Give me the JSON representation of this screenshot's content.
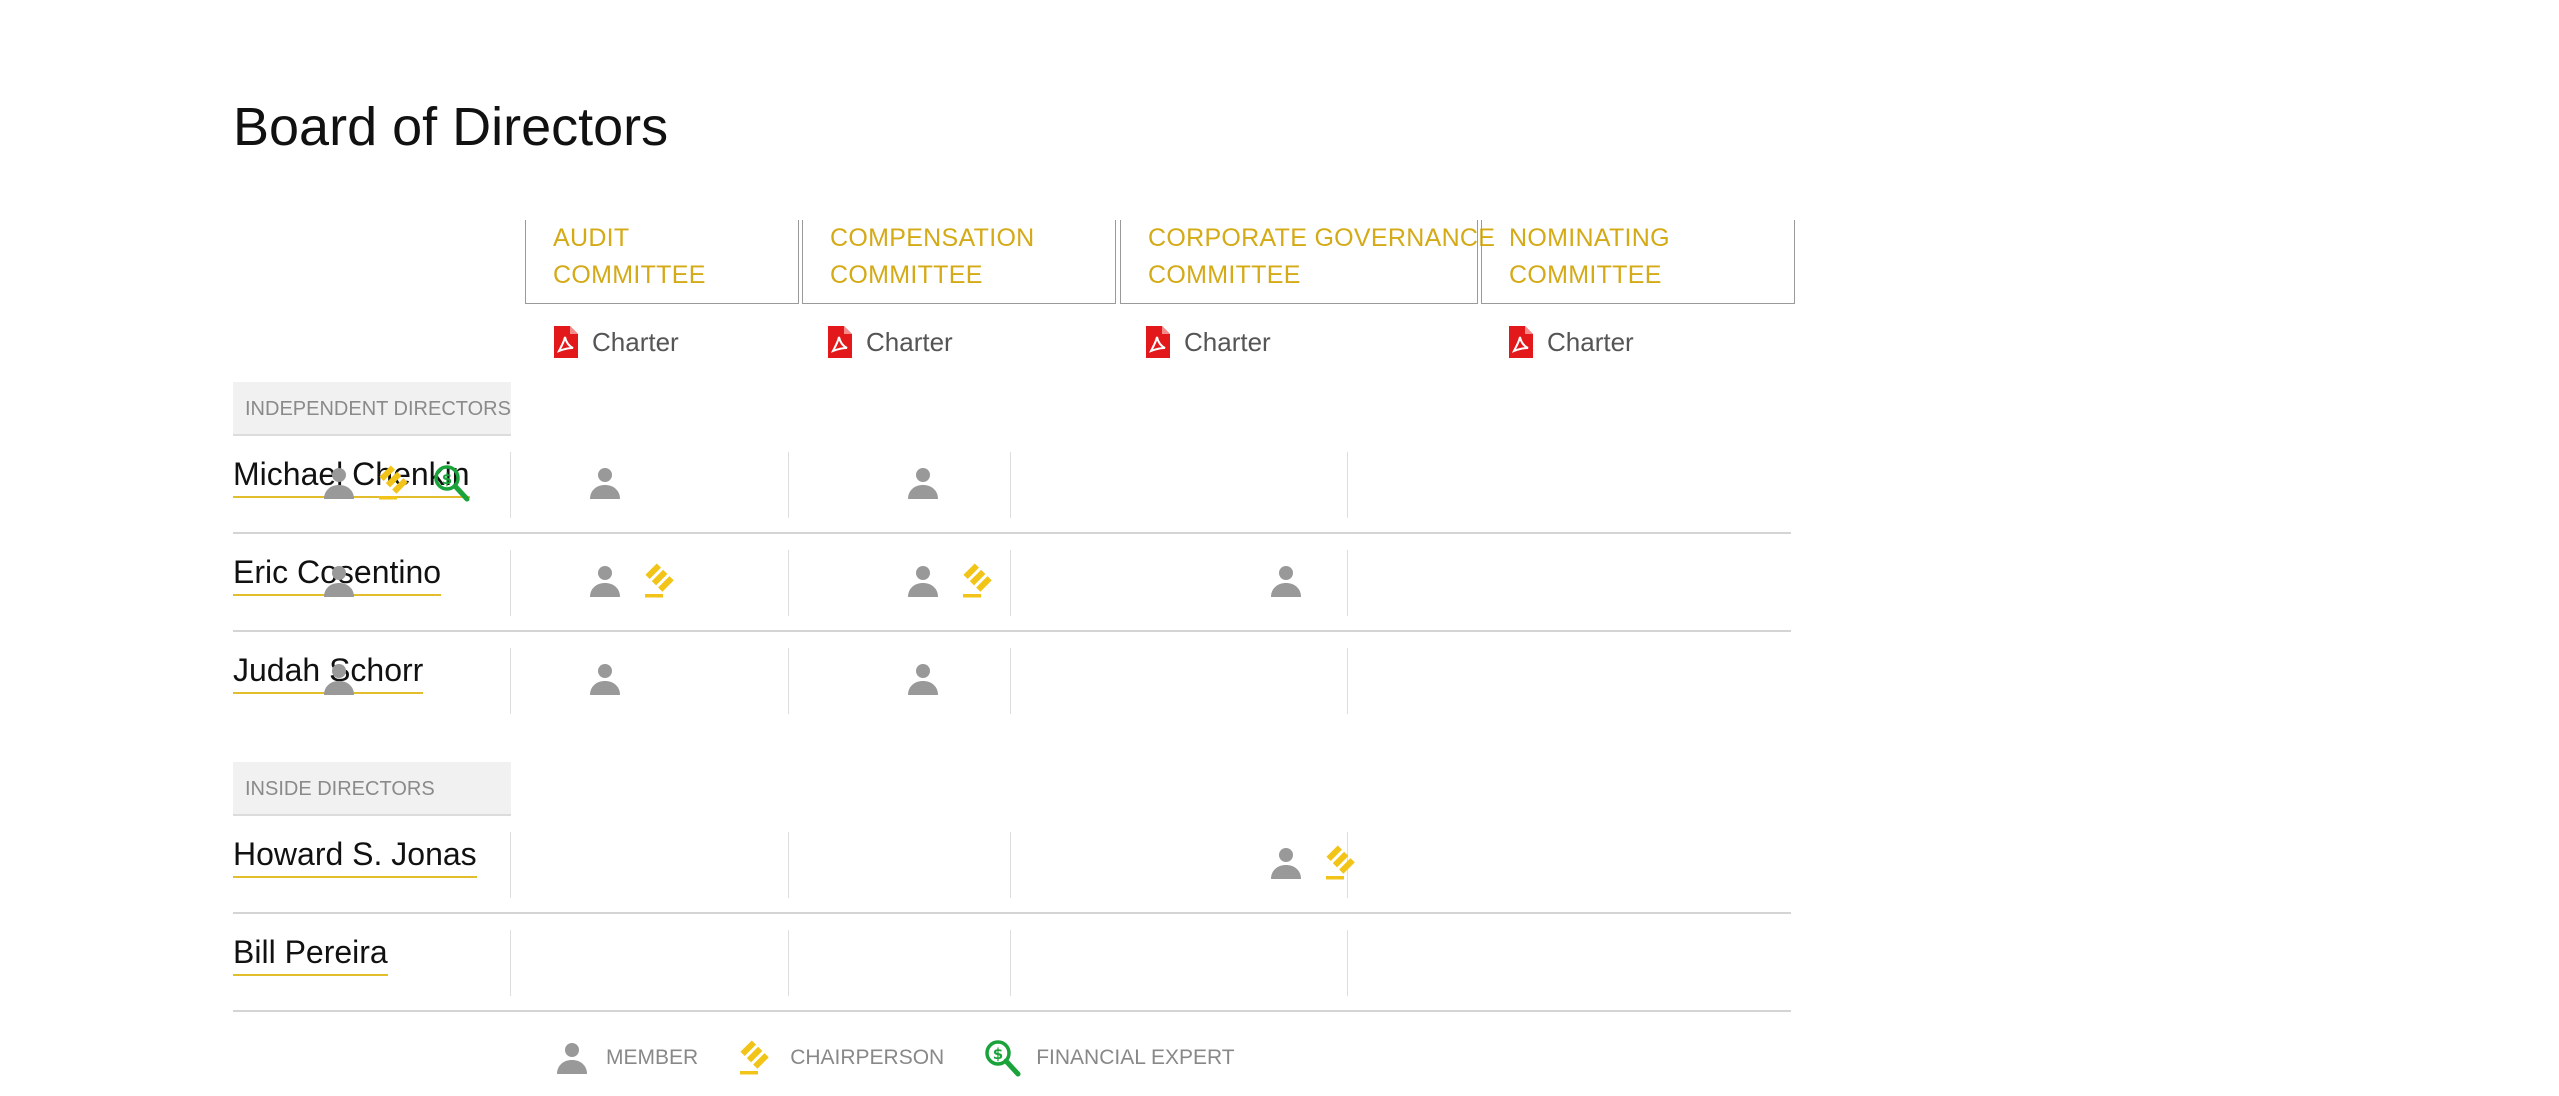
{
  "page": {
    "title": "Board of Directors"
  },
  "committees": [
    {
      "line1": "AUDIT",
      "line2": "COMMITTEE",
      "charter": "Charter"
    },
    {
      "line1": "COMPENSATION",
      "line2": "COMMITTEE",
      "charter": "Charter"
    },
    {
      "line1": "CORPORATE GOVERNANCE",
      "line2": "COMMITTEE",
      "charter": "Charter"
    },
    {
      "line1": "NOMINATING",
      "line2": "COMMITTEE",
      "charter": "Charter"
    }
  ],
  "sections": {
    "independent": {
      "label": "INDEPENDENT DIRECTORS"
    },
    "inside": {
      "label": "INSIDE DIRECTORS"
    }
  },
  "directors": {
    "independent": [
      {
        "name": "Michael Chenkin",
        "roles": [
          [
            "member",
            "chair",
            "expert"
          ],
          [
            "member"
          ],
          [
            "member"
          ],
          []
        ]
      },
      {
        "name": "Eric Cosentino",
        "roles": [
          [
            "member"
          ],
          [
            "member",
            "chair"
          ],
          [
            "member",
            "chair"
          ],
          [
            "member"
          ]
        ]
      },
      {
        "name": "Judah Schorr",
        "roles": [
          [
            "member"
          ],
          [
            "member"
          ],
          [
            "member"
          ],
          []
        ]
      }
    ],
    "inside": [
      {
        "name": "Howard S. Jonas",
        "roles": [
          [],
          [],
          [],
          [
            "member",
            "chair"
          ]
        ]
      },
      {
        "name": "Bill Pereira",
        "roles": [
          [],
          [],
          [],
          []
        ]
      }
    ]
  },
  "legend": {
    "member": "MEMBER",
    "chair": "CHAIRPERSON",
    "expert": "FINANCIAL EXPERT"
  },
  "colors": {
    "accent": "#d4aa17",
    "chair_icon": "#f2c417",
    "expert_icon": "#1aa33a",
    "member_icon": "#999999",
    "pdf_icon": "#e3181b"
  },
  "icons": {
    "member": "person-icon",
    "chair": "gavel-icon",
    "expert": "dollar-magnifier-icon",
    "pdf": "pdf-icon"
  }
}
